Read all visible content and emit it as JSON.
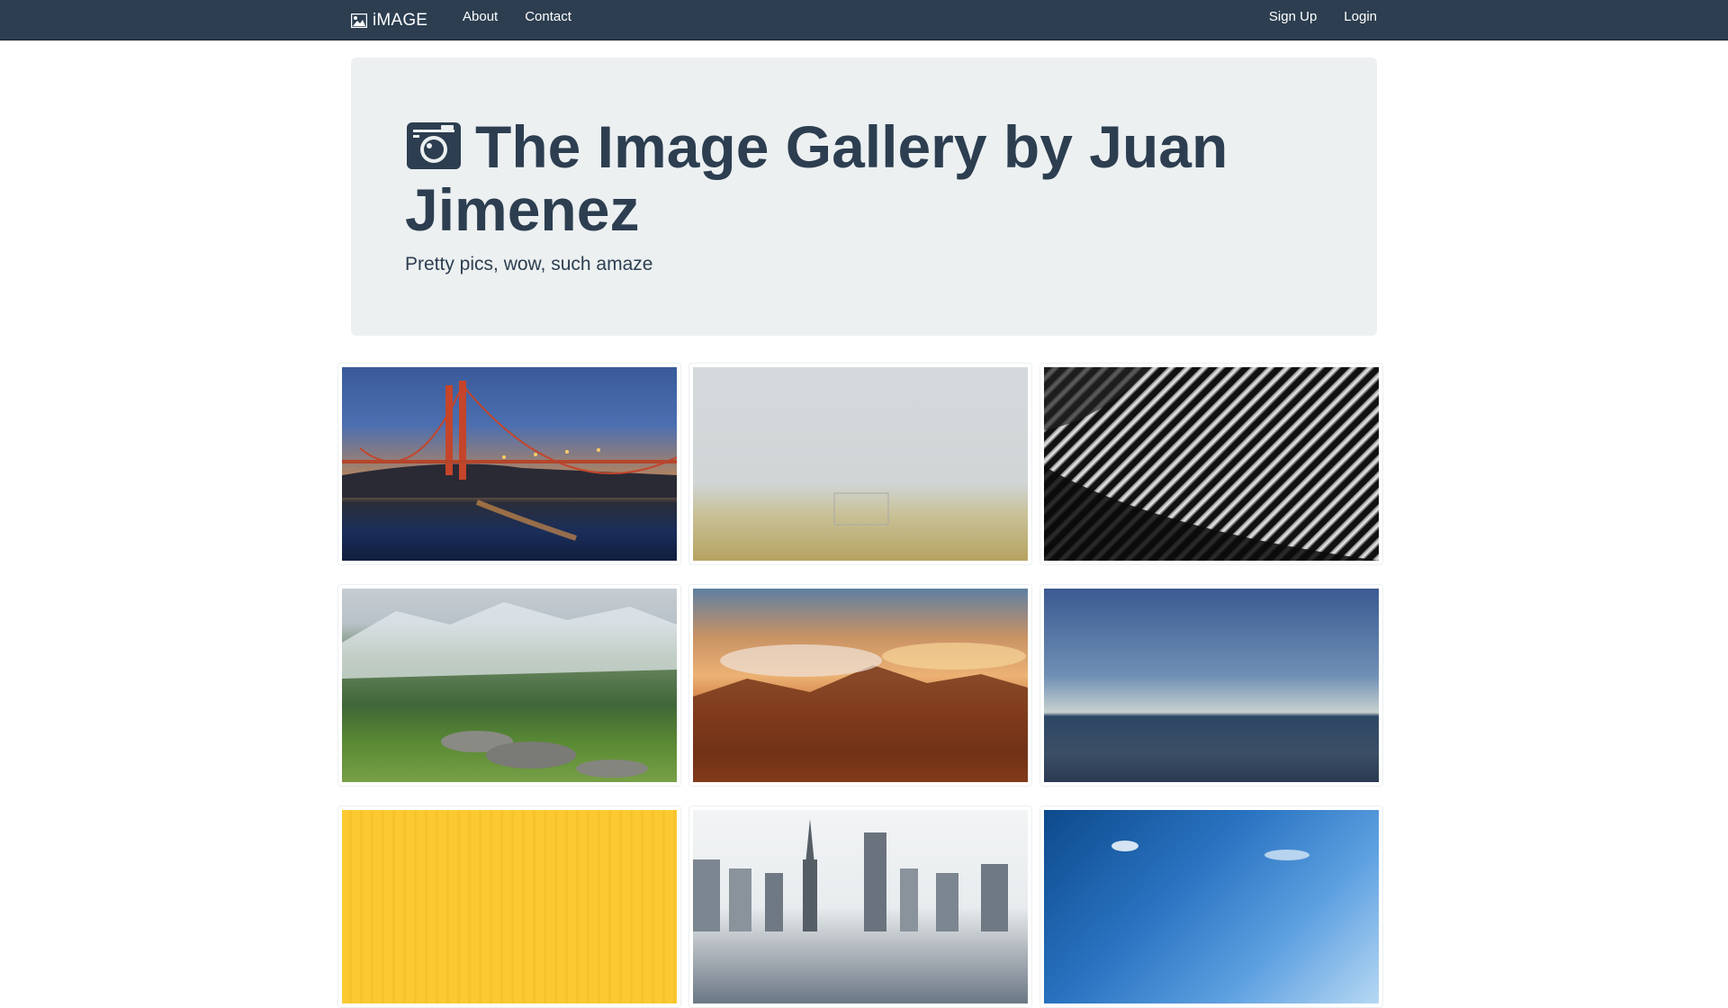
{
  "navbar": {
    "brand": "iMAGE",
    "brand_icon": "picture-icon",
    "left_links": [
      {
        "label": "About"
      },
      {
        "label": "Contact"
      }
    ],
    "right_links": [
      {
        "label": "Sign Up"
      },
      {
        "label": "Login"
      }
    ],
    "background_color": "#2c3e50"
  },
  "jumbotron": {
    "icon": "camera-icon",
    "title": "The Image Gallery by Juan Jimenez",
    "subtitle": "Pretty pics, wow, such amaze",
    "background_color": "#ecf0f1",
    "text_color": "#2c3e50"
  },
  "gallery": {
    "images": [
      {
        "subject": "golden-gate-bridge-at-dusk"
      },
      {
        "subject": "foggy-field-with-goal"
      },
      {
        "subject": "abstract-black-white-architecture"
      },
      {
        "subject": "green-mountain-valley"
      },
      {
        "subject": "sunset-over-mountain-clouds"
      },
      {
        "subject": "calm-ocean-horizon"
      },
      {
        "subject": "yellow-texture"
      },
      {
        "subject": "city-skyline"
      },
      {
        "subject": "blue-sky"
      }
    ]
  }
}
